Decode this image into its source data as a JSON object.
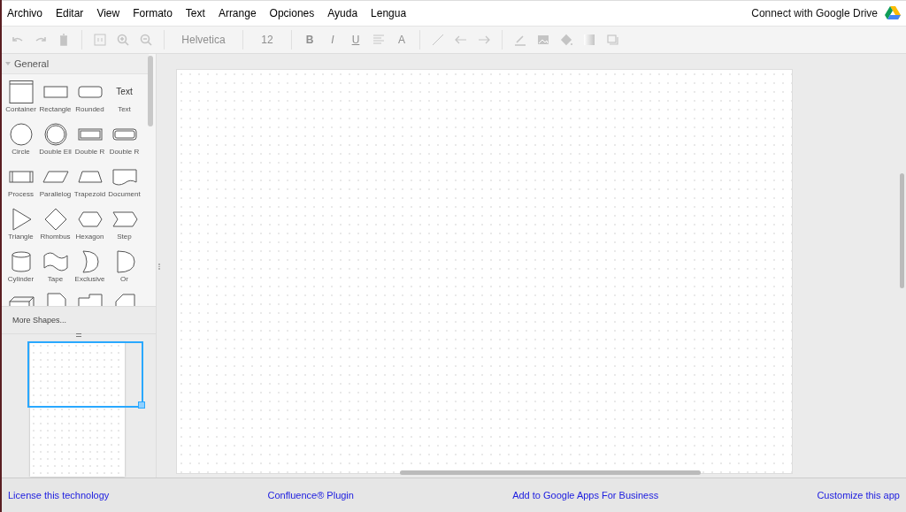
{
  "menu": [
    "Archivo",
    "Editar",
    "View",
    "Formato",
    "Text",
    "Arrange",
    "Opciones",
    "Ayuda",
    "Lengua"
  ],
  "drive": {
    "label": "Connect with Google Drive"
  },
  "toolbar": [
    {
      "kind": "undo",
      "disabled": true
    },
    {
      "kind": "redo",
      "disabled": true
    },
    {
      "kind": "delete",
      "disabled": true
    },
    {
      "kind": "sep"
    },
    {
      "kind": "actual",
      "disabled": true
    },
    {
      "kind": "zoomin",
      "disabled": true
    },
    {
      "kind": "zoomout",
      "disabled": true
    },
    {
      "kind": "sep"
    },
    {
      "kind": "font",
      "label": "Helvetica",
      "disabled": true
    },
    {
      "kind": "sep"
    },
    {
      "kind": "size",
      "label": "12",
      "disabled": true
    },
    {
      "kind": "sep"
    },
    {
      "kind": "bold",
      "label": "B",
      "disabled": true
    },
    {
      "kind": "italic",
      "label": "I",
      "disabled": true
    },
    {
      "kind": "underline",
      "label": "U",
      "disabled": true
    },
    {
      "kind": "align",
      "disabled": true
    },
    {
      "kind": "fontcolor",
      "label": "A",
      "disabled": true
    },
    {
      "kind": "sep"
    },
    {
      "kind": "line",
      "disabled": true
    },
    {
      "kind": "arrowleft",
      "disabled": true
    },
    {
      "kind": "arrowright",
      "disabled": true
    },
    {
      "kind": "sep"
    },
    {
      "kind": "linecolor",
      "disabled": true
    },
    {
      "kind": "image",
      "disabled": true
    },
    {
      "kind": "fill",
      "disabled": true
    },
    {
      "kind": "gradient",
      "disabled": true
    },
    {
      "kind": "shadow",
      "disabled": true
    }
  ],
  "sidebar": {
    "section": {
      "title": "General",
      "expanded": true
    },
    "shapes": [
      {
        "kind": "container",
        "label": "Container"
      },
      {
        "kind": "rectangle",
        "label": "Rectangle"
      },
      {
        "kind": "rounded",
        "label": "Rounded"
      },
      {
        "kind": "text",
        "label": "Text"
      },
      {
        "kind": "circle",
        "label": "Circle"
      },
      {
        "kind": "doubleellipse",
        "label": "Double Ell"
      },
      {
        "kind": "doublerect",
        "label": "Double R"
      },
      {
        "kind": "doublerounded",
        "label": "Double R"
      },
      {
        "kind": "process",
        "label": "Process"
      },
      {
        "kind": "parallelogram",
        "label": "Parallelog"
      },
      {
        "kind": "trapezoid",
        "label": "Trapezoid"
      },
      {
        "kind": "document",
        "label": "Document"
      },
      {
        "kind": "triangle",
        "label": "Triangle"
      },
      {
        "kind": "rhombus",
        "label": "Rhombus"
      },
      {
        "kind": "hexagon",
        "label": "Hexagon"
      },
      {
        "kind": "step",
        "label": "Step"
      },
      {
        "kind": "cylinder",
        "label": "Cylinder"
      },
      {
        "kind": "tape",
        "label": "Tape"
      },
      {
        "kind": "exclusive",
        "label": "Exclusive"
      },
      {
        "kind": "or",
        "label": "Or"
      }
    ],
    "text_sample": "Text",
    "partial_shapes": [
      {
        "kind": "cube"
      },
      {
        "kind": "note"
      },
      {
        "kind": "folder"
      },
      {
        "kind": "card"
      }
    ],
    "more": "More Shapes..."
  },
  "footer": [
    "License this technology",
    "Confluence® Plugin",
    "Add to Google Apps For Business",
    "Customize this app"
  ]
}
